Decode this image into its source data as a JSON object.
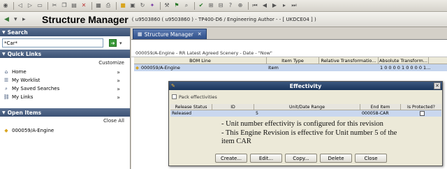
{
  "toolbar": {
    "icons": [
      "app-icon",
      "back-icon",
      "forward-icon",
      "window-icon",
      "cut-icon",
      "copy-icon",
      "paste-icon",
      "delete-icon",
      "layout-icon",
      "print-icon",
      "open-icon",
      "save-icon",
      "refresh-icon",
      "wand-icon",
      "tool-icon",
      "flag-icon",
      "search-icon",
      "check-icon",
      "where-used-icon",
      "filter-icon",
      "help-icon",
      "zoom-icon",
      "first-icon",
      "previous-icon",
      "play-icon",
      "next-icon",
      "last-icon"
    ]
  },
  "titlebar": {
    "title": "Structure Manager",
    "context": "( u9503860 ( u9503860 ) - TP400-D6 / Engineering Author - - [ UKDCE04 ] )"
  },
  "left": {
    "search_header": "Search",
    "search_value": "*Car*",
    "quick_links_header": "Quick Links",
    "customize": "Customize",
    "links": [
      {
        "label": "Home",
        "icon": "home-icon"
      },
      {
        "label": "My Worklist",
        "icon": "worklist-icon"
      },
      {
        "label": "My Saved Searches",
        "icon": "saved-search-icon"
      },
      {
        "label": "My Links",
        "icon": "links-icon"
      }
    ],
    "open_items_header": "Open Items",
    "close_all": "Close All",
    "open_items": [
      {
        "label": "000059/A-Engine",
        "icon": "item-icon"
      }
    ]
  },
  "main": {
    "tab_label": "Structure Manager",
    "breadcrumb": "000059/A-Engine - RR Latest Agreed Scenery - Date - \"Now\"",
    "bom_columns": [
      "BOM Line",
      "Item Type",
      "Relative Transformatio...",
      "Absolute Transform...",
      ""
    ],
    "bom_rows": [
      {
        "line": "000059/A-Engine",
        "type": "Item",
        "relative": "",
        "absolute": "1 0 0 0 0 1 0 0 0 0 1..."
      }
    ]
  },
  "dialog": {
    "title": "Effectivity",
    "pack_label": "Pack effectivities",
    "columns": [
      "Release Status",
      "ID",
      "Unit/Date Range",
      "End Item",
      "Is Protected?"
    ],
    "rows": [
      {
        "status": "Released",
        "id": "",
        "range": "5",
        "end_item": "000058-CAR",
        "protected": false
      }
    ],
    "note_lines": [
      "- Unit number effectivity is configured for this revision",
      "- This Engine Revision is effective for Unit number 5 of the",
      "item CAR"
    ],
    "buttons": [
      "Create...",
      "Edit...",
      "Copy...",
      "Delete",
      "Close"
    ]
  },
  "colors": {
    "header_blue": "#3c5275",
    "selection": "#c5d5ee",
    "dialog_title": "#1a355c"
  }
}
